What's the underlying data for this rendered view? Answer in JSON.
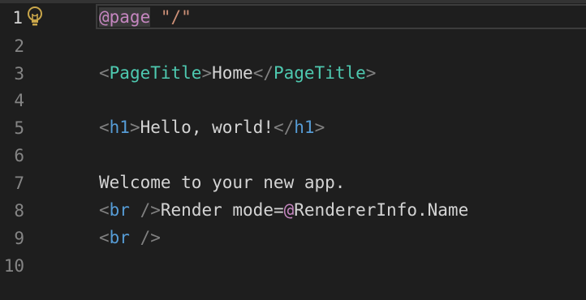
{
  "editor": {
    "line_numbers": [
      "1",
      "2",
      "3",
      "4",
      "5",
      "6",
      "7",
      "8",
      "9",
      "10"
    ],
    "active_line": "1",
    "lightbulb_icon": "lightbulb-icon",
    "lines": {
      "l1": {
        "directive": "@page",
        "space": " ",
        "string": "\"/\""
      },
      "l3": {
        "open_lt": "<",
        "open_tag": "PageTitle",
        "open_gt": ">",
        "text": "Home",
        "close_lt": "</",
        "close_tag": "PageTitle",
        "close_gt": ">"
      },
      "l5": {
        "open_lt": "<",
        "open_tag": "h1",
        "open_gt": ">",
        "text": "Hello, world!",
        "close_lt": "</",
        "close_tag": "h1",
        "close_gt": ">"
      },
      "l7": {
        "text": "Welcome to your new app."
      },
      "l8": {
        "lt": "<",
        "tag": "br",
        "slash_gt": " />",
        "text": "Render mode=",
        "at": "@",
        "obj": "RendererInfo",
        "dot": ".",
        "prop": "Name"
      },
      "l9": {
        "lt": "<",
        "tag": "br",
        "slash_gt": " />"
      }
    }
  },
  "colors": {
    "background": "#1e1e1e",
    "directive": "#c586c0",
    "string": "#ce9178",
    "component": "#4ec9b0",
    "html_tag": "#569cd6",
    "punctuation": "#808080",
    "text": "#d4d4d4",
    "line_number": "#858585"
  }
}
